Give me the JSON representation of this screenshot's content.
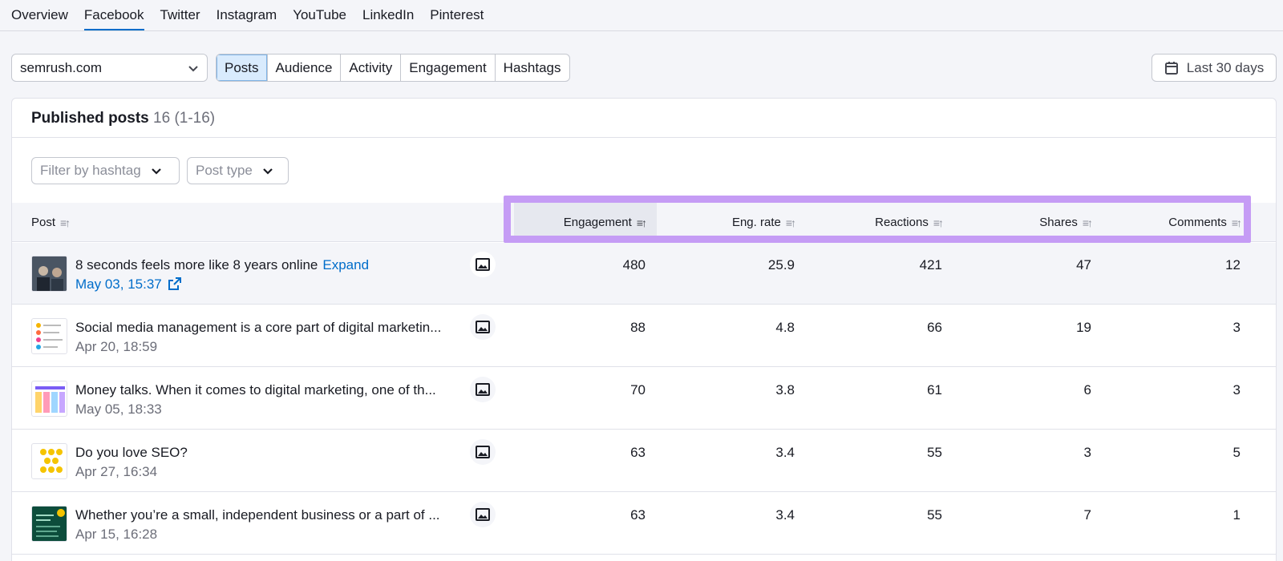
{
  "top_tabs": [
    "Overview",
    "Facebook",
    "Twitter",
    "Instagram",
    "YouTube",
    "LinkedIn",
    "Pinterest"
  ],
  "active_top_tab": "Facebook",
  "domain": "semrush.com",
  "report_tabs": [
    "Posts",
    "Audience",
    "Activity",
    "Engagement",
    "Hashtags"
  ],
  "active_report_tab": "Posts",
  "date_range": "Last 30 days",
  "card": {
    "title": "Published posts",
    "count": "16 (1-16)"
  },
  "filters": {
    "hashtag": "Filter by hashtag",
    "post_type": "Post type"
  },
  "columns": {
    "post": "Post",
    "engagement": "Engagement",
    "eng_rate": "Eng. rate",
    "reactions": "Reactions",
    "shares": "Shares",
    "comments": "Comments"
  },
  "rows": [
    {
      "text": "8 seconds feels more like 8 years online",
      "expand": "Expand",
      "date": "May 03, 15:37",
      "engagement": "480",
      "eng_rate": "25.9",
      "reactions": "421",
      "shares": "47",
      "comments": "12"
    },
    {
      "text": "Social media management is a core part of digital marketin...",
      "date": "Apr 20, 18:59",
      "engagement": "88",
      "eng_rate": "4.8",
      "reactions": "66",
      "shares": "19",
      "comments": "3"
    },
    {
      "text": "Money talks. When it comes to digital marketing, one of th...",
      "date": "May 05, 18:33",
      "engagement": "70",
      "eng_rate": "3.8",
      "reactions": "61",
      "shares": "6",
      "comments": "3"
    },
    {
      "text": "Do you love SEO?",
      "date": "Apr 27, 16:34",
      "engagement": "63",
      "eng_rate": "3.4",
      "reactions": "55",
      "shares": "3",
      "comments": "5"
    },
    {
      "text": "Whether you’re a small, independent business or a part of ...",
      "date": "Apr 15, 16:28",
      "engagement": "63",
      "eng_rate": "3.4",
      "reactions": "55",
      "shares": "7",
      "comments": "1"
    }
  ],
  "colors": {
    "accent": "#006dca",
    "highlight": "#c59cf5",
    "active_seg": "#d9ebfd"
  }
}
